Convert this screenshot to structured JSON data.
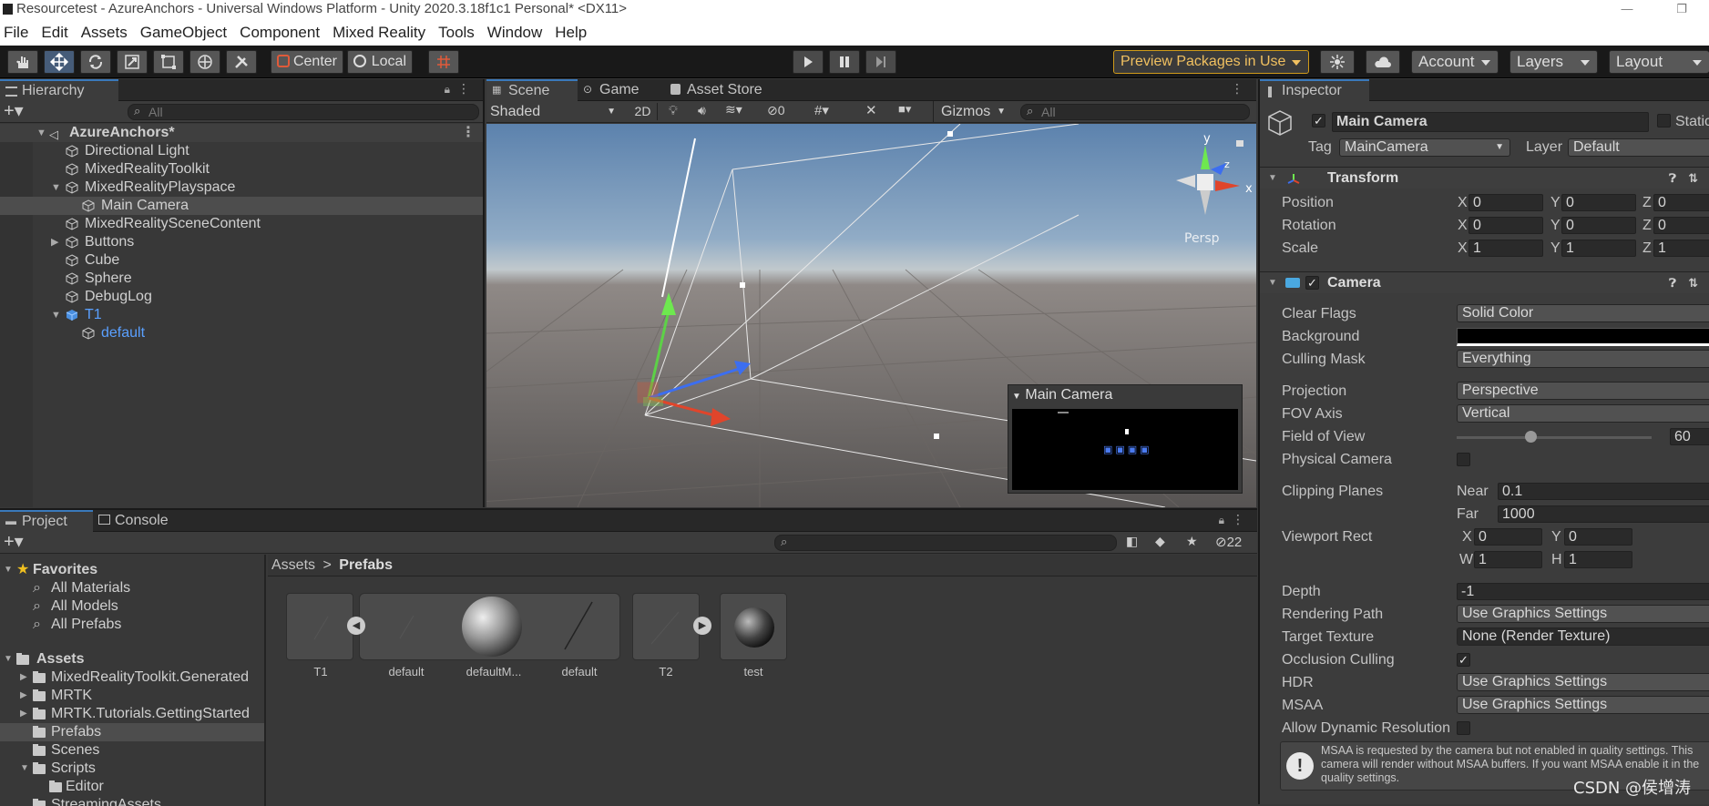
{
  "window": {
    "title": "Resourcetest - AzureAnchors - Universal Windows Platform - Unity 2020.3.18f1c1 Personal* <DX11>"
  },
  "menu": [
    "File",
    "Edit",
    "Assets",
    "GameObject",
    "Component",
    "Mixed Reality",
    "Tools",
    "Window",
    "Help"
  ],
  "toolbar": {
    "center_label": "Center",
    "local_label": "Local",
    "preview_label": "Preview Packages in Use",
    "account_label": "Account",
    "layers_label": "Layers",
    "layout_label": "Layout"
  },
  "hierarchy": {
    "tab": "Hierarchy",
    "search_placeholder": "All",
    "scene": "AzureAnchors*",
    "items": [
      {
        "label": "Directional Light"
      },
      {
        "label": "MixedRealityToolkit"
      },
      {
        "label": "MixedRealityPlayspace"
      },
      {
        "label": "Main Camera"
      },
      {
        "label": "MixedRealitySceneContent"
      },
      {
        "label": "Buttons"
      },
      {
        "label": "Cube"
      },
      {
        "label": "Sphere"
      },
      {
        "label": "DebugLog"
      },
      {
        "label": "T1"
      },
      {
        "label": "default"
      }
    ]
  },
  "scene": {
    "tabs": [
      "Scene",
      "Game",
      "Asset Store"
    ],
    "shading": "Shaded",
    "mode_2d": "2D",
    "hidden_count": "0",
    "gizmos": "Gizmos",
    "search_placeholder": "All",
    "persp_label": "Persp",
    "axis_x": "x",
    "axis_y": "y",
    "axis_z": "z",
    "camera_preview_title": "Main Camera"
  },
  "project": {
    "tabs": [
      "Project",
      "Console"
    ],
    "hidden_count": "22",
    "favorites_label": "Favorites",
    "favorites": [
      "All Materials",
      "All Models",
      "All Prefabs"
    ],
    "assets_label": "Assets",
    "folders": [
      "MixedRealityToolkit.Generated",
      "MRTK",
      "MRTK.Tutorials.GettingStarted",
      "Prefabs",
      "Scenes",
      "Scripts",
      "Editor",
      "StreamingAssets"
    ],
    "breadcrumb_root": "Assets",
    "breadcrumb_sep": ">",
    "breadcrumb_current": "Prefabs",
    "thumbs": [
      "T1",
      "default",
      "defaultM...",
      "default",
      "T2",
      "test"
    ]
  },
  "inspector": {
    "tab": "Inspector",
    "object_name": "Main Camera",
    "static_label": "Static",
    "tag_label": "Tag",
    "tag_value": "MainCamera",
    "layer_label": "Layer",
    "layer_value": "Default",
    "transform": {
      "title": "Transform",
      "position_label": "Position",
      "rotation_label": "Rotation",
      "scale_label": "Scale",
      "axis_x": "X",
      "axis_y": "Y",
      "axis_z": "Z",
      "position": [
        "0",
        "0",
        "0"
      ],
      "rotation": [
        "0",
        "0",
        "0"
      ],
      "scale": [
        "1",
        "1",
        "1"
      ]
    },
    "camera": {
      "title": "Camera",
      "clear_flags_label": "Clear Flags",
      "clear_flags": "Solid Color",
      "background_label": "Background",
      "background_color": "#000000",
      "culling_mask_label": "Culling Mask",
      "culling_mask": "Everything",
      "projection_label": "Projection",
      "projection": "Perspective",
      "fov_axis_label": "FOV Axis",
      "fov_axis": "Vertical",
      "fov_label": "Field of View",
      "fov": "60",
      "fov_fraction": 0.38,
      "physical_label": "Physical Camera",
      "clipping_label": "Clipping Planes",
      "near_label": "Near",
      "near": "0.1",
      "far_label": "Far",
      "far": "1000",
      "viewport_label": "Viewport Rect",
      "vp_x_label": "X",
      "vp_x": "0",
      "vp_y_label": "Y",
      "vp_y": "0",
      "vp_w_label": "W",
      "vp_w": "1",
      "vp_h_label": "H",
      "vp_h": "1",
      "depth_label": "Depth",
      "depth": "-1",
      "rendering_path_label": "Rendering Path",
      "rendering_path": "Use Graphics Settings",
      "target_texture_label": "Target Texture",
      "target_texture": "None (Render Texture)",
      "occlusion_label": "Occlusion Culling",
      "hdr_label": "HDR",
      "hdr": "Use Graphics Settings",
      "msaa_label": "MSAA",
      "msaa": "Use Graphics Settings",
      "dynres_label": "Allow Dynamic Resolution",
      "warning": "MSAA is requested by the camera but not enabled in quality settings. This camera will render without MSAA buffers. If you want MSAA enable it in the quality settings."
    }
  },
  "watermark": "CSDN @侯增涛"
}
